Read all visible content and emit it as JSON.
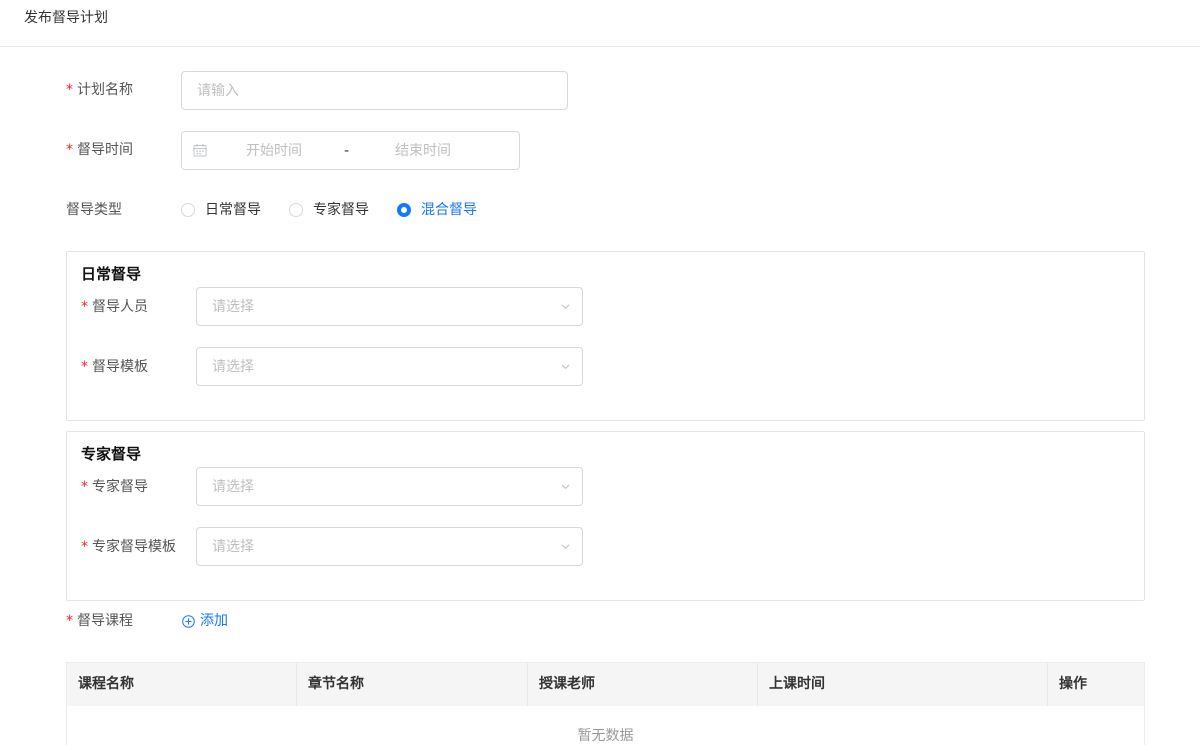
{
  "header": {
    "title": "发布督导计划"
  },
  "form": {
    "plan_name": {
      "label": "计划名称",
      "placeholder": "请输入"
    },
    "time": {
      "label": "督导时间",
      "start_placeholder": "开始时间",
      "separator": "-",
      "end_placeholder": "结束时间"
    },
    "type": {
      "label": "督导类型",
      "options": [
        {
          "label": "日常督导",
          "checked": false
        },
        {
          "label": "专家督导",
          "checked": false
        },
        {
          "label": "混合督导",
          "checked": true
        }
      ]
    }
  },
  "daily_panel": {
    "title": "日常督导",
    "staff": {
      "label": "督导人员",
      "placeholder": "请选择"
    },
    "template": {
      "label": "督导模板",
      "placeholder": "请选择"
    }
  },
  "expert_panel": {
    "title": "专家督导",
    "expert": {
      "label": "专家督导",
      "placeholder": "请选择"
    },
    "template": {
      "label": "专家督导模板",
      "placeholder": "请选择"
    }
  },
  "courses": {
    "label": "督导课程",
    "add_label": "添加",
    "columns": [
      "课程名称",
      "章节名称",
      "授课老师",
      "上课时间",
      "操作"
    ],
    "empty_text": "暂无数据"
  },
  "colors": {
    "primary": "#1677ff",
    "required": "#f5222d",
    "border": "#d9d9d9",
    "placeholder": "#bfbfbf"
  }
}
